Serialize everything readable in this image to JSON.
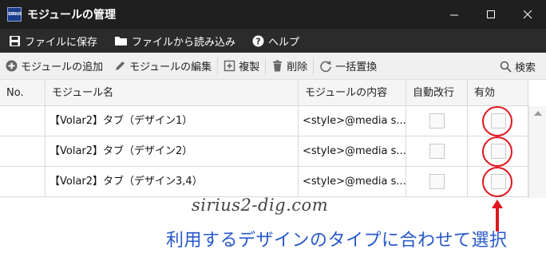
{
  "window": {
    "title": "モジュールの管理",
    "app_icon_text": "SIRIUS",
    "buttons": [
      "minimize",
      "maximize",
      "close"
    ]
  },
  "menu": {
    "save": "ファイルに保存",
    "load": "ファイルから読み込み",
    "help": "ヘルプ"
  },
  "toolbar": {
    "add": "モジュールの追加",
    "edit": "モジュールの編集",
    "duplicate": "複製",
    "delete": "削除",
    "replace": "一括置換",
    "search": "検索"
  },
  "table": {
    "columns": [
      "No.",
      "モジュール名",
      "モジュールの内容",
      "自動改行",
      "有効"
    ],
    "rows": [
      {
        "no": "",
        "name": "【Volar2】タブ（デザイン1）",
        "content": "<style>@media s...",
        "auto_wrap": false,
        "enabled": false
      },
      {
        "no": "",
        "name": "【Volar2】タブ（デザイン2）",
        "content": "<style>@media s...",
        "auto_wrap": false,
        "enabled": false
      },
      {
        "no": "",
        "name": "【Volar2】タブ（デザイン3,4）",
        "content": "<style>@media s...",
        "auto_wrap": false,
        "enabled": false
      }
    ]
  },
  "annotation": {
    "watermark": "sirius2-dig.com",
    "caption": "利用するデザインのタイプに合わせて選択",
    "highlight_color": "#e0161e",
    "caption_color": "#2758c9"
  }
}
